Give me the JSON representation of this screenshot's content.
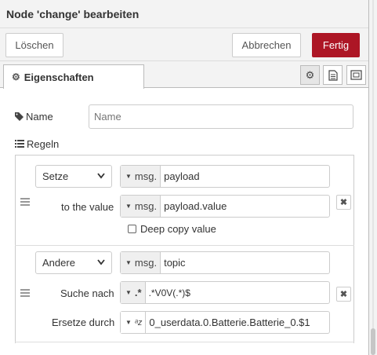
{
  "header": {
    "title": "Node 'change' bearbeiten"
  },
  "toolbar": {
    "delete_label": "Löschen",
    "cancel_label": "Abbrechen",
    "done_label": "Fertig"
  },
  "tabs": {
    "properties_label": "Eigenschaften",
    "icons": [
      "gear-icon",
      "description-icon",
      "appearance-icon"
    ]
  },
  "form": {
    "name_label": "Name",
    "name_placeholder": "Name",
    "name_value": "",
    "rules_label": "Regeln"
  },
  "rules": [
    {
      "action": "Setze",
      "target_type": "msg.",
      "target_value": "payload",
      "value_label": "to the value",
      "value_type": "msg.",
      "value_value": "payload.value",
      "deep_copy_label": "Deep copy value",
      "deep_copy_checked": false
    },
    {
      "action": "Andere",
      "target_type": "msg.",
      "target_value": "topic",
      "search_label": "Suche nach",
      "search_type": ".*",
      "search_value": ".*V0V(.*)$",
      "replace_label": "Ersetze durch",
      "replace_type": "az",
      "replace_value": "0_userdata.0.Batterie.Batterie_0.$1"
    }
  ],
  "colors": {
    "primary": "#ad1625",
    "header_bg": "#f3f3f3"
  }
}
